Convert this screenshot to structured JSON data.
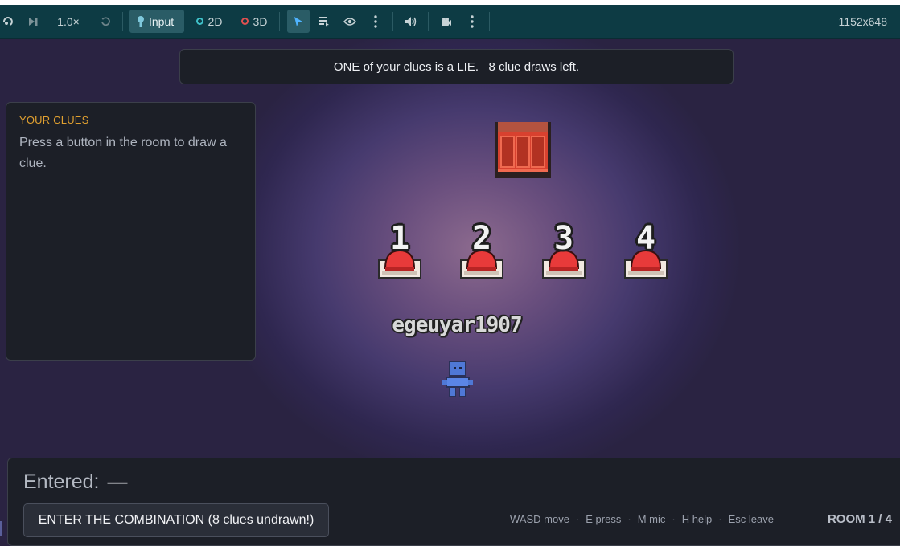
{
  "toolbar": {
    "speed": "1.0×",
    "input_label": "Input",
    "mode_2d": "2D",
    "mode_3d": "3D",
    "resolution": "1152x648",
    "colors": {
      "ring_2d": "#3fc1c9",
      "ring_3d": "#e05050",
      "select_icon": "#4fb3ff"
    }
  },
  "banner": {
    "text": "ONE of your clues is a LIE.   8 clue draws left."
  },
  "clues_panel": {
    "title": "YOUR CLUES",
    "body": "Press a button in the room to draw a clue."
  },
  "room": {
    "buttons": [
      {
        "label": "1"
      },
      {
        "label": "2"
      },
      {
        "label": "3"
      },
      {
        "label": "4"
      }
    ],
    "player_name": "egeuyar1907",
    "colors": {
      "button_red": "#e83a3a",
      "door_red": "#d8412f",
      "player_blue": "#4f78d6"
    }
  },
  "bottom_bar": {
    "entered_label": "Entered:",
    "entered_value": "—",
    "combination_button": "ENTER THE COMBINATION (8 clues undrawn!)",
    "hints": [
      "WASD move",
      "E press",
      "M mic",
      "H help",
      "Esc leave"
    ],
    "room_counter": "ROOM 1 / 4"
  }
}
